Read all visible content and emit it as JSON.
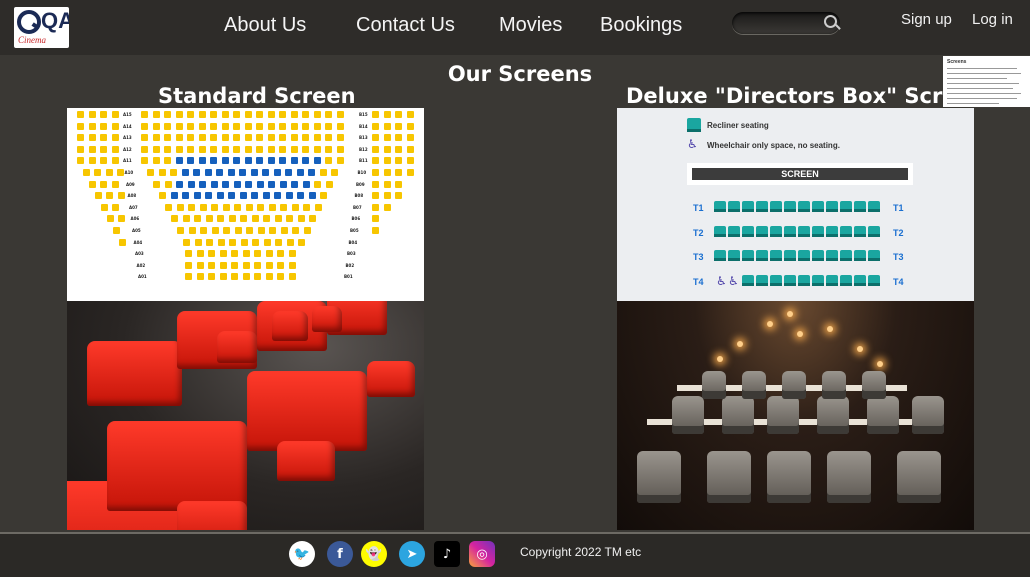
{
  "header": {
    "logo_text": "QA",
    "logo_script": "Cinema",
    "nav": [
      "About Us",
      "Contact Us",
      "Movies",
      "Bookings"
    ],
    "search_placeholder": "",
    "signup": "Sign up",
    "login": "Log in"
  },
  "page": {
    "title": "Our Screens",
    "standard_heading": "Standard Screen",
    "deluxe_heading": "Deluxe \"Directors Box\" Screen"
  },
  "standard_plan": {
    "left_row_labels": [
      "A15",
      "A14",
      "A13",
      "A12",
      "A11",
      "A10",
      "A09",
      "A08",
      "A07",
      "A06",
      "A05",
      "A04",
      "A03",
      "A02",
      "A01"
    ],
    "right_row_labels": [
      "B15",
      "B14",
      "B13",
      "B12",
      "B11",
      "B10",
      "B09",
      "B08",
      "B07",
      "B06",
      "B05",
      "B04",
      "B03",
      "B02",
      "B01"
    ],
    "seat_color": "#f7c600",
    "premium_color": "#1560bd"
  },
  "deluxe_plan": {
    "legend_recliner": "Recliner seating",
    "legend_wheelchair": "Wheelchair only space, no seating.",
    "screen_label": "SCREEN",
    "rows": [
      "T1",
      "T2",
      "T3",
      "T4"
    ]
  },
  "thumbnail": {
    "title": "Screens"
  },
  "footer": {
    "social": [
      "twitter",
      "facebook",
      "snapchat",
      "telegram",
      "tiktok",
      "instagram"
    ],
    "copyright": "Copyright 2022 TM etc"
  }
}
